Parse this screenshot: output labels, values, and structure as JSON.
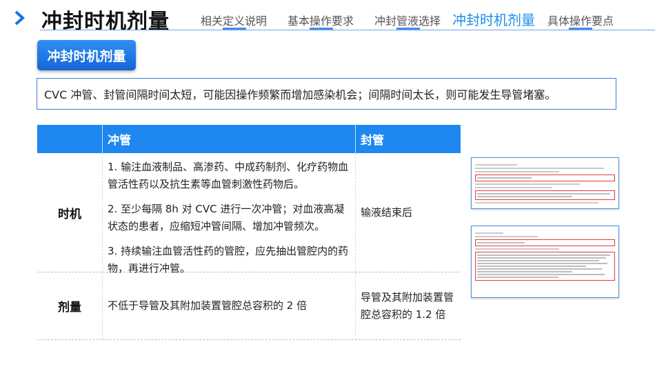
{
  "header": {
    "title": "冲封时机剂量",
    "nav_tabs": [
      {
        "label": "相关定义说明",
        "active": false
      },
      {
        "label": "基本操作要求",
        "active": false
      },
      {
        "label": "冲封管液选择",
        "active": false
      },
      {
        "label": "冲封时机剂量",
        "active": true
      },
      {
        "label": "具体操作要点",
        "active": false
      }
    ]
  },
  "section_badge": "冲封时机剂量",
  "summary": "CVC 冲管、封管间隔时间太短，可能因操作频繁而增加感染机会；间隔时间太长，则可能发生导管堵塞。",
  "table": {
    "headers": [
      "",
      "冲管",
      "封管"
    ],
    "rows": [
      {
        "label": "时机",
        "flush": [
          "1. 输注血液制品、高渗药、中成药制剂、化疗药物血管活性药以及抗生素等血管刺激性药物后。",
          "2. 至少每隔 8h 对 CVC 进行一次冲管；对血液高凝状态的患者，应缩短冲管间隔、增加冲管频次。",
          "3. 持续输注血管活性药的管腔，应先抽出管腔内的药物，再进行冲管。"
        ],
        "lock": "输液结束后"
      },
      {
        "label": "剂量",
        "flush": "不低于导管及其附加装置管腔总容积的 2 倍",
        "lock": "导管及其附加装置管腔总容积的 1.2 倍"
      }
    ]
  },
  "colors": {
    "accent": "#1a8cf0",
    "table_header": "#1e87f0",
    "badge": "#1565d8",
    "highlight_box": "#e03a3a"
  },
  "thumbnails": [
    {
      "icon": "document-thumbnail"
    },
    {
      "icon": "document-thumbnail"
    }
  ]
}
